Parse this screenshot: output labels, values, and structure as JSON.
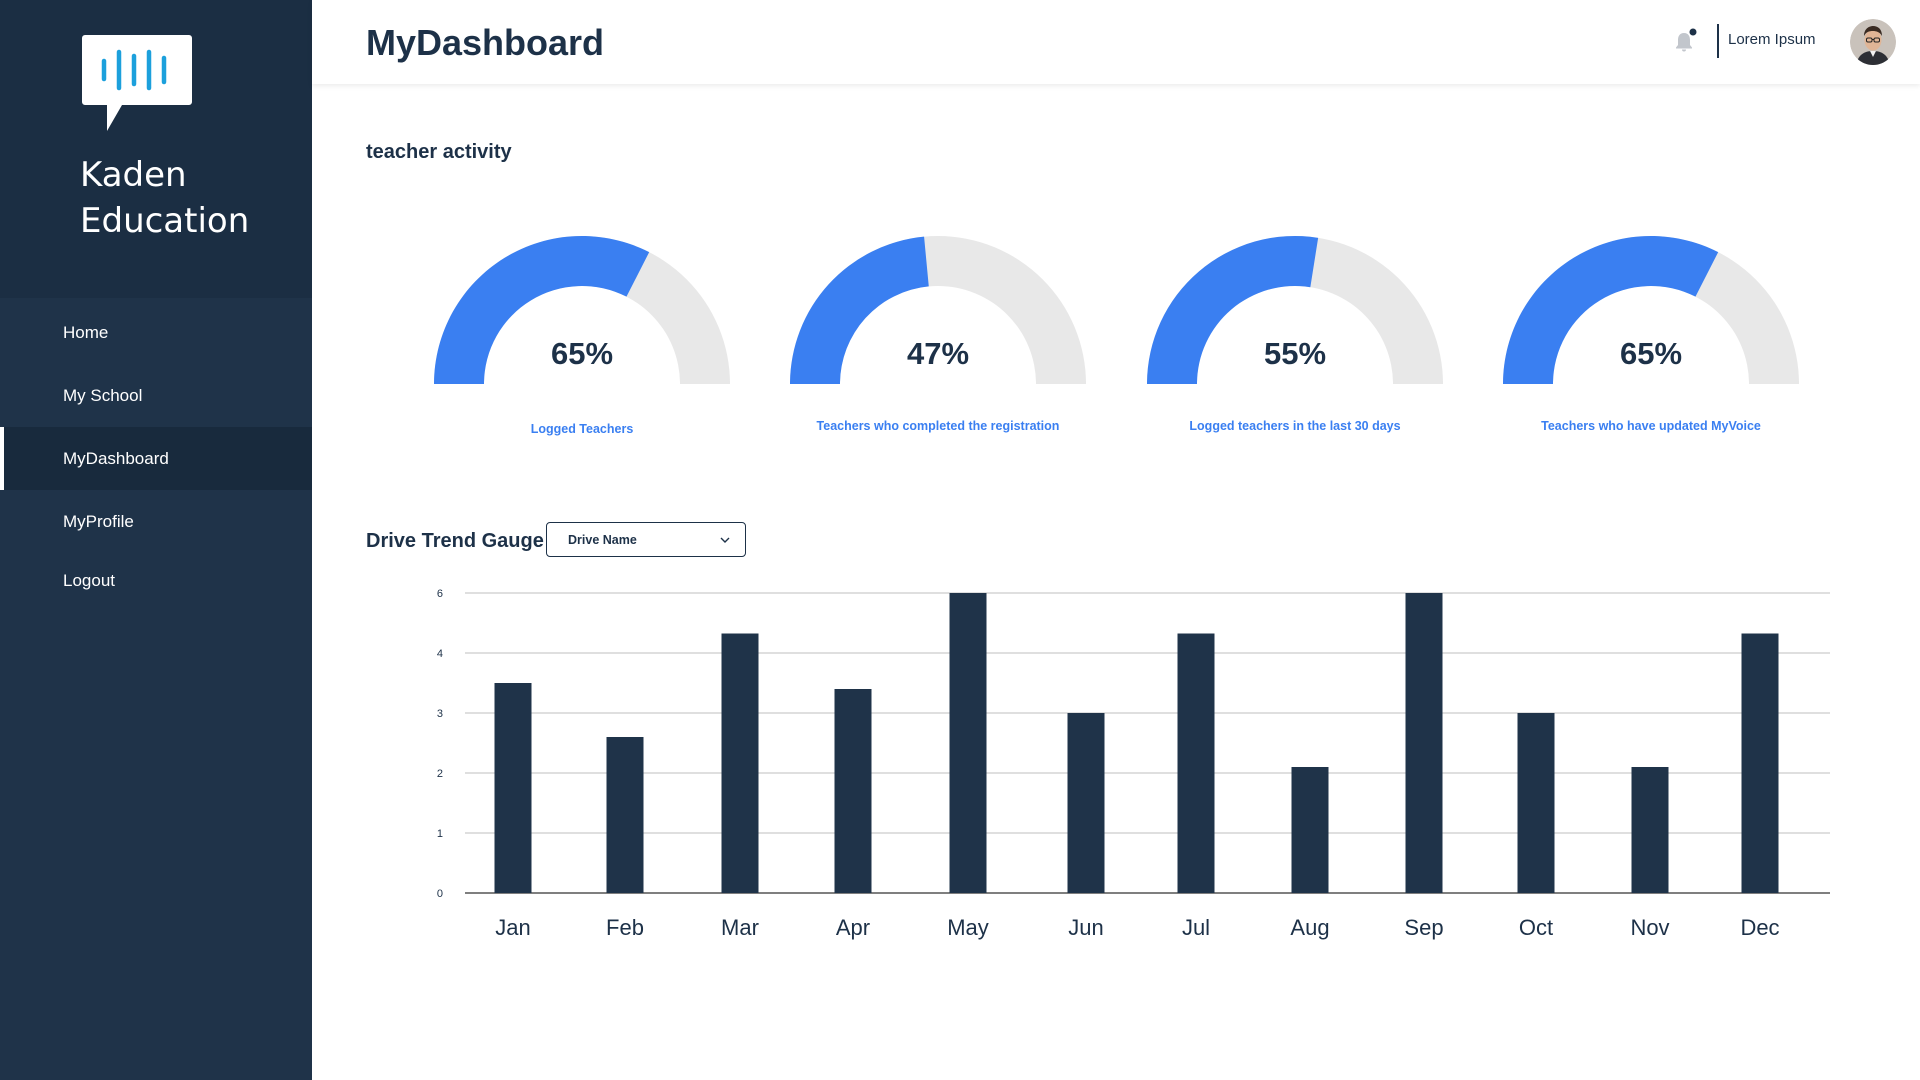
{
  "brand": {
    "name": "Kaden Education"
  },
  "sidebar": {
    "items": [
      {
        "label": "Home"
      },
      {
        "label": "My School"
      },
      {
        "label": "MyDashboard",
        "active": true
      },
      {
        "label": "MyProfile"
      },
      {
        "label": "Logout"
      }
    ]
  },
  "header": {
    "title": "MyDashboard",
    "user_name": "Lorem Ipsum",
    "notification_icon": "bell-icon",
    "has_notification_dot": true
  },
  "teacher_activity": {
    "title": "teacher activity",
    "gauges": [
      {
        "value": "65%",
        "percent": 65,
        "label": "Logged Teachers"
      },
      {
        "value": "47%",
        "percent": 47,
        "label": "Teachers who completed the registration"
      },
      {
        "value": "55%",
        "percent": 55,
        "label": "Logged teachers in the last 30 days"
      },
      {
        "value": "65%",
        "percent": 65,
        "label": "Teachers who have updated MyVoice"
      }
    ]
  },
  "drive_trend": {
    "title": "Drive Trend Gauge",
    "dropdown": {
      "selected": "Drive Name"
    }
  },
  "colors": {
    "sidebar": "#1f3349",
    "brand_block": "#1b2e43",
    "accent": "#3a7ff1",
    "gauge_track": "#e8e8e8",
    "bar": "#1f3349",
    "title_text": "#1d3148"
  },
  "chart_data": {
    "type": "bar",
    "categories": [
      "Jan",
      "Feb",
      "Mar",
      "Apr",
      "May",
      "Jun",
      "Jul",
      "Aug",
      "Sep",
      "Oct",
      "Nov",
      "Dec"
    ],
    "values": [
      3.5,
      2.6,
      4.65,
      3.4,
      6,
      3,
      4.65,
      2.1,
      6,
      3,
      2.1,
      4.65
    ],
    "yticks": [
      0,
      1,
      2,
      3,
      4,
      6
    ],
    "ylim": [
      0,
      6
    ],
    "grid": true,
    "title": "",
    "xlabel": "",
    "ylabel": ""
  }
}
